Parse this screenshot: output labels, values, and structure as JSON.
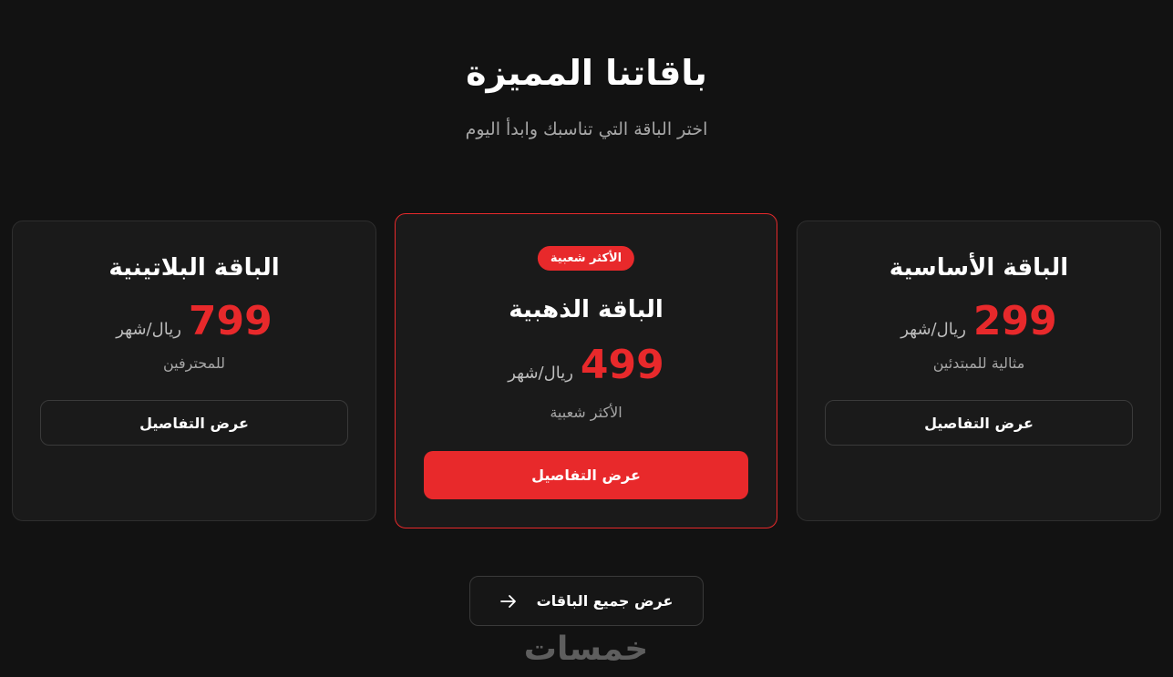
{
  "header": {
    "title": "باقاتنا المميزة",
    "subtitle": "اختر الباقة التي تناسبك وابدأ اليوم"
  },
  "plans": {
    "basic": {
      "name": "الباقة الأساسية",
      "price": "299",
      "period": "ريال/شهر",
      "description": "مثالية للمبتدئين",
      "button_label": "عرض التفاصيل"
    },
    "gold": {
      "badge": "الأكثر شعبية",
      "name": "الباقة الذهبية",
      "price": "499",
      "period": "ريال/شهر",
      "description": "الأكثر شعبية",
      "button_label": "عرض التفاصيل"
    },
    "platinum": {
      "name": "الباقة البلاتينية",
      "price": "799",
      "period": "ريال/شهر",
      "description": "للمحترفين",
      "button_label": "عرض التفاصيل"
    }
  },
  "footer": {
    "all_plans_label": "عرض جميع الباقات",
    "arrow_icon": "arrow-right-icon",
    "brand_logo": "خمسات"
  },
  "colors": {
    "background": "#121212",
    "card": "#1a1a1a",
    "accent": "#e8292b",
    "muted_text": "#a6a6a6"
  }
}
